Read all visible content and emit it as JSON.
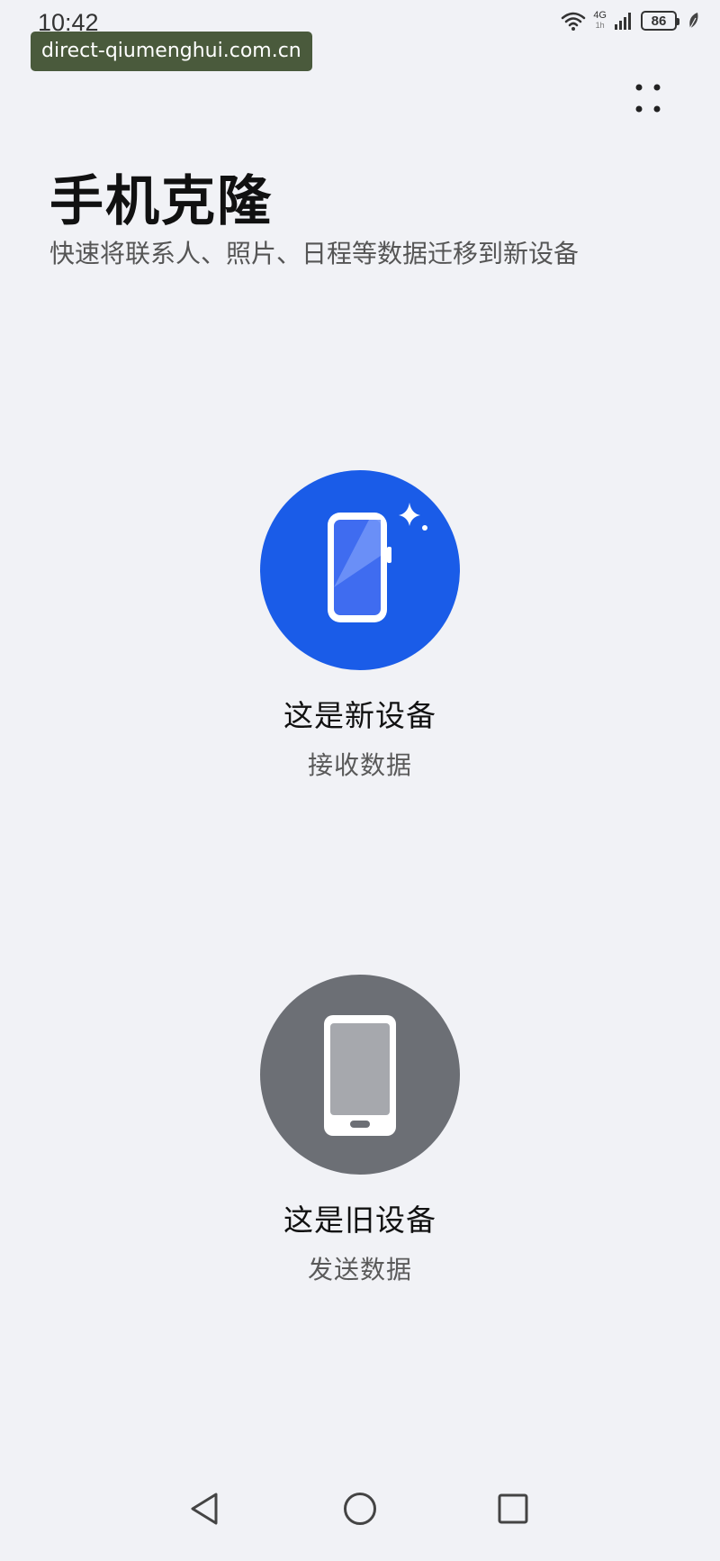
{
  "status_bar": {
    "time": "10:42",
    "network_label": "4G",
    "network_sub": "1h",
    "battery_level": "86",
    "icons": [
      "wifi-icon",
      "signal-icon",
      "battery-icon",
      "leaf-icon"
    ]
  },
  "watermark": {
    "text": "direct-qiumenghui.com.cn"
  },
  "header": {
    "title": "手机克隆",
    "subtitle": "快速将联系人、照片、日程等数据迁移到新设备"
  },
  "options": {
    "new_device": {
      "title": "这是新设备",
      "subtitle": "接收数据",
      "icon": "new-phone-icon",
      "color": "#1a5ce8"
    },
    "old_device": {
      "title": "这是旧设备",
      "subtitle": "发送数据",
      "icon": "old-phone-icon",
      "color": "#6c6f75"
    }
  },
  "menu": {
    "icon": "more-icon"
  },
  "nav_bar": {
    "icons": [
      "back-icon",
      "home-icon",
      "recents-icon"
    ]
  }
}
